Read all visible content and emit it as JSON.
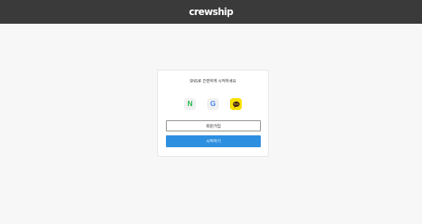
{
  "header": {
    "logo_text": "crewship"
  },
  "card": {
    "title": "SNS로 간편하게 시작하세요",
    "sns_buttons": [
      {
        "icon": "naver-icon",
        "label": "N",
        "color": "#1fb845"
      },
      {
        "icon": "google-icon",
        "label": "G",
        "color": "#4285f4"
      },
      {
        "icon": "kakao-icon",
        "color": "#f8e000"
      }
    ],
    "signup_label": "회원가입",
    "start_label": "시작하기"
  },
  "colors": {
    "header_bg": "#3a3a3a",
    "page_bg": "#f7f7f7",
    "primary_button": "#2d8fe0",
    "kakao_yellow": "#f8e000",
    "naver_green": "#1fb845"
  }
}
